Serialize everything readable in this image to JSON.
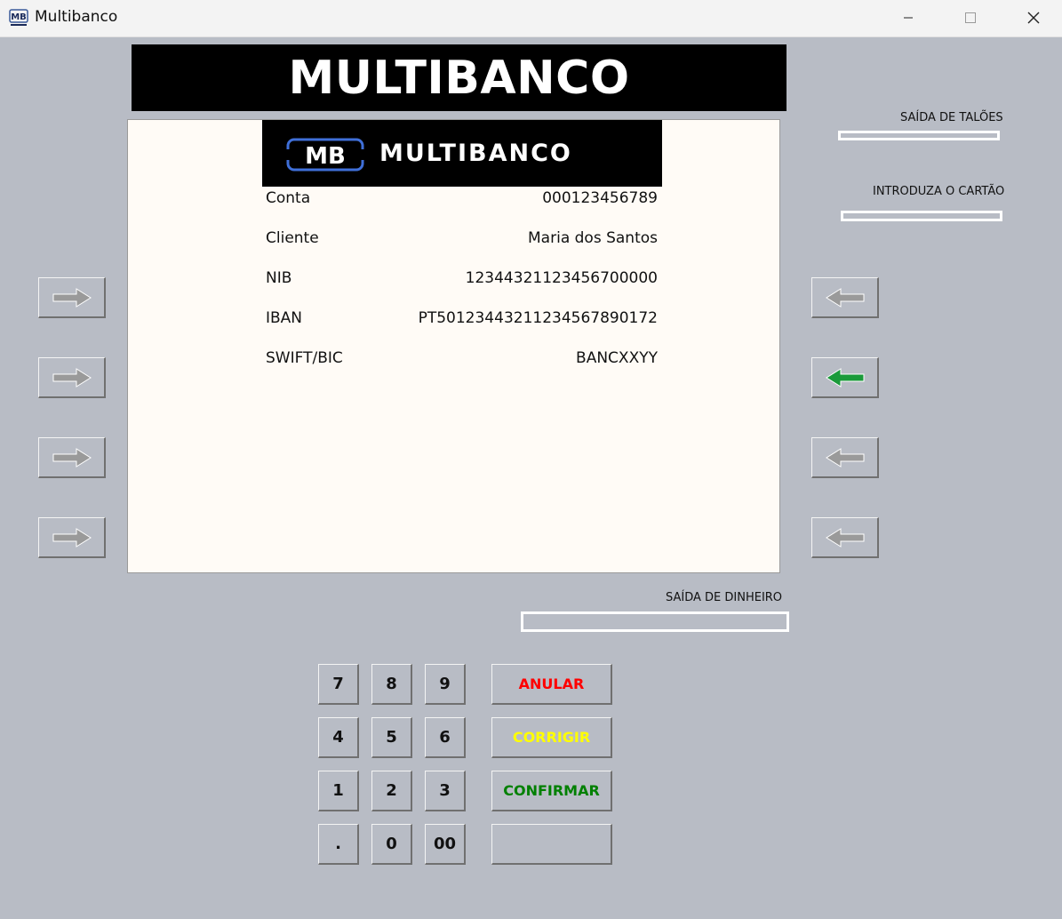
{
  "window": {
    "title": "Multibanco",
    "icon": "mb-logo-icon",
    "controls": [
      "minimize-icon",
      "maximize-icon",
      "close-icon"
    ]
  },
  "banner": {
    "title": "MULTIBANCO"
  },
  "screen": {
    "logo": {
      "mark": "MB",
      "word": "MULTIBANCO"
    },
    "rows": [
      {
        "label": "Conta",
        "value": "000123456789"
      },
      {
        "label": "Cliente",
        "value": "Maria dos Santos"
      },
      {
        "label": "NIB",
        "value": "12344321123456700000"
      },
      {
        "label": "IBAN",
        "value": "PT50123443211234567890172"
      },
      {
        "label": "SWIFT/BIC",
        "value": "BANCXXYY"
      }
    ]
  },
  "side_buttons": {
    "left": [
      {
        "icon": "arrow-right-icon",
        "active": false
      },
      {
        "icon": "arrow-right-icon",
        "active": false
      },
      {
        "icon": "arrow-right-icon",
        "active": false
      },
      {
        "icon": "arrow-right-icon",
        "active": false
      }
    ],
    "right": [
      {
        "icon": "arrow-left-icon",
        "active": false
      },
      {
        "icon": "arrow-left-icon",
        "active": true
      },
      {
        "icon": "arrow-left-icon",
        "active": false
      },
      {
        "icon": "arrow-left-icon",
        "active": false
      }
    ]
  },
  "slots": {
    "receipt": "SAÍDA DE TALÕES",
    "card": "INTRODUZA O CARTÃO",
    "cash": "SAÍDA DE DINHEIRO"
  },
  "keypad": {
    "keys": [
      "7",
      "8",
      "9",
      "4",
      "5",
      "6",
      "1",
      "2",
      "3",
      ".",
      "0",
      "00"
    ],
    "functions": [
      {
        "label": "ANULAR",
        "color": "#ff0000"
      },
      {
        "label": "CORRIGIR",
        "color": "#ffff00"
      },
      {
        "label": "CONFIRMAR",
        "color": "#008000"
      },
      {
        "label": "",
        "color": "#000000"
      }
    ]
  },
  "colors": {
    "body": "#b8bcc5",
    "screen": "#fffbf6",
    "active_arrow": "#1a9a3a",
    "inactive_arrow": "#9a9a9a"
  }
}
